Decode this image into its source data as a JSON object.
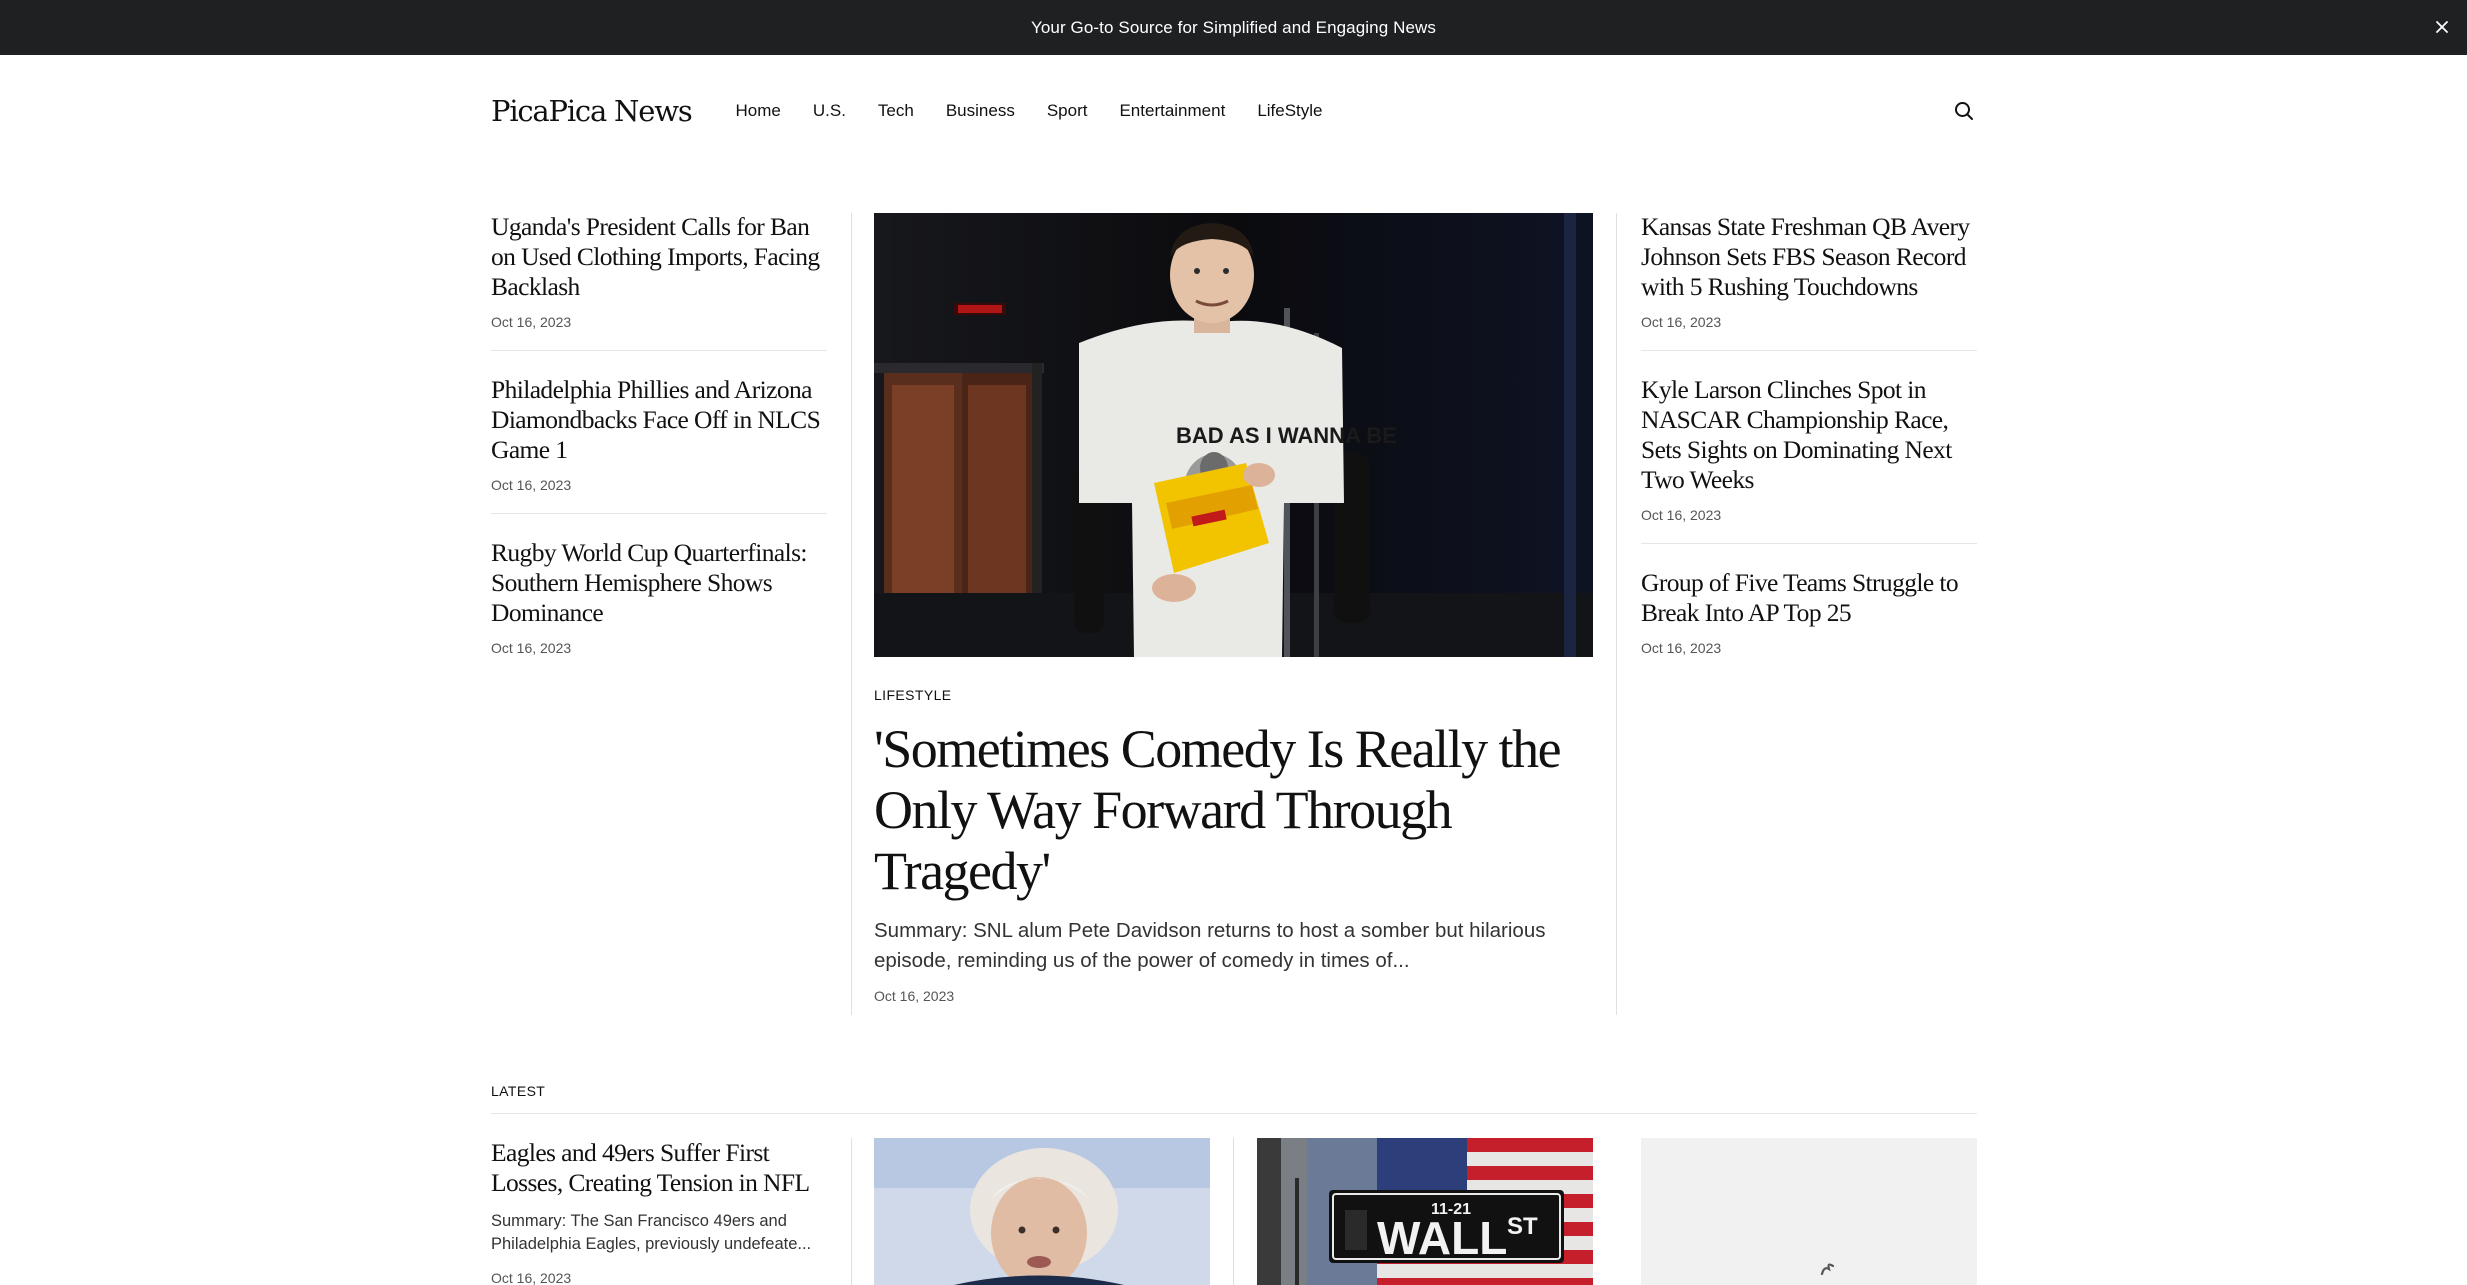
{
  "announcement": {
    "text": "Your Go-to Source for Simplified and Engaging News",
    "close_icon": "close-icon"
  },
  "header": {
    "logo": "PicaPica News",
    "nav": [
      "Home",
      "U.S.",
      "Tech",
      "Business",
      "Sport",
      "Entertainment",
      "LifeStyle"
    ],
    "search_icon": "search-icon"
  },
  "left_stories": [
    {
      "title": "Uganda's President Calls for Ban on Used Clothing Imports, Facing Backlash",
      "date": "Oct 16, 2023"
    },
    {
      "title": "Philadelphia Phillies and Arizona Diamondbacks Face Off in NLCS Game 1",
      "date": "Oct 16, 2023"
    },
    {
      "title": "Rugby World Cup Quarterfinals: Southern Hemisphere Shows Dominance",
      "date": "Oct 16, 2023"
    }
  ],
  "hero": {
    "category": "LIFESTYLE",
    "title": "'Sometimes Comedy Is Really the Only Way Forward Through Tragedy'",
    "summary": "Summary: SNL alum Pete Davidson returns to host a somber but hilarious episode, reminding us of the power of comedy in times of...",
    "date": "Oct 16, 2023",
    "image_shirt_text": "BAD AS I WANNA BE"
  },
  "right_stories": [
    {
      "title": "Kansas State Freshman QB Avery Johnson Sets FBS Season Record with 5 Rushing Touchdowns",
      "date": "Oct 16, 2023"
    },
    {
      "title": "Kyle Larson Clinches Spot in NASCAR Championship Race, Sets Sights on Dominating Next Two Weeks",
      "date": "Oct 16, 2023"
    },
    {
      "title": "Group of Five Teams Struggle to Break Into AP Top 25",
      "date": "Oct 16, 2023"
    }
  ],
  "latest": {
    "label": "LATEST",
    "first": {
      "title": "Eagles and 49ers Suffer First Losses, Creating Tension in NFL",
      "summary": "Summary: The San Francisco 49ers and Philadelphia Eagles, previously undefeate...",
      "date": "Oct 16, 2023"
    },
    "wall_sign": {
      "number": "11-21",
      "street": "WALL",
      "suffix": "ST"
    }
  }
}
